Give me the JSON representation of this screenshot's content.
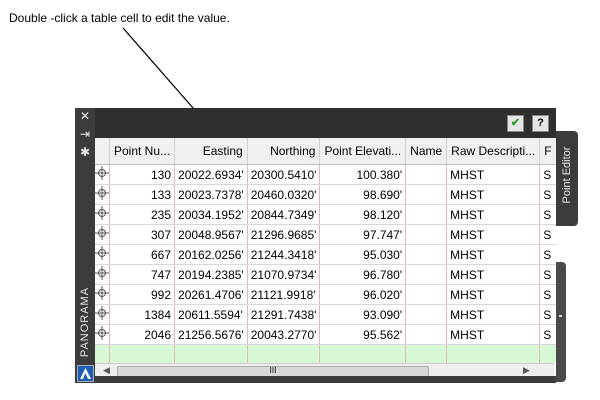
{
  "callout": {
    "text": "Double -click a table cell to edit the value."
  },
  "sidebar": {
    "close_glyph": "✕",
    "pin_glyph": "⇥",
    "settings_glyph": "✱",
    "palette_label": "PANORAMA"
  },
  "titlebar": {
    "ok_glyph": "✔",
    "help_label": "?"
  },
  "tab": {
    "label": "Point Editor"
  },
  "table": {
    "columns": [
      "",
      "Point Nu...",
      "Easting",
      "Northing",
      "Point Elevati...",
      "Name",
      "Raw Descripti...",
      "F"
    ],
    "rows": [
      {
        "num": "130",
        "easting": "20022.6934'",
        "northing": "20300.5410'",
        "elev": "100.380'",
        "name": "",
        "raw": "MHST",
        "f": "S"
      },
      {
        "num": "133",
        "easting": "20023.7378'",
        "northing": "20460.0320'",
        "elev": "98.690'",
        "name": "",
        "raw": "MHST",
        "f": "S"
      },
      {
        "num": "235",
        "easting": "20034.1952'",
        "northing": "20844.7349'",
        "elev": "98.120'",
        "name": "",
        "raw": "MHST",
        "f": "S"
      },
      {
        "num": "307",
        "easting": "20048.9567'",
        "northing": "21296.9685'",
        "elev": "97.747'",
        "name": "",
        "raw": "MHST",
        "f": "S"
      },
      {
        "num": "667",
        "easting": "20162.0256'",
        "northing": "21244.3418'",
        "elev": "95.030'",
        "name": "",
        "raw": "MHST",
        "f": "S"
      },
      {
        "num": "747",
        "easting": "20194.2385'",
        "northing": "21070.9734'",
        "elev": "96.780'",
        "name": "",
        "raw": "MHST",
        "f": "S"
      },
      {
        "num": "992",
        "easting": "20261.4706'",
        "northing": "21121.9918'",
        "elev": "96.020'",
        "name": "",
        "raw": "MHST",
        "f": "S"
      },
      {
        "num": "1384",
        "easting": "20611.5594'",
        "northing": "21291.7438'",
        "elev": "93.090'",
        "name": "",
        "raw": "MHST",
        "f": "S"
      },
      {
        "num": "2046",
        "easting": "21256.5676'",
        "northing": "20043.2770'",
        "elev": "95.562'",
        "name": "",
        "raw": "MHST",
        "f": "S"
      }
    ],
    "new_row_color": "#d8f7d4"
  },
  "scrollbar": {
    "left_glyph": "◀",
    "right_glyph": "▶",
    "grip_glyph": "III"
  },
  "colors": {
    "panel_dark": "#2f2f2f",
    "cell_border": "#e3b8b8"
  }
}
